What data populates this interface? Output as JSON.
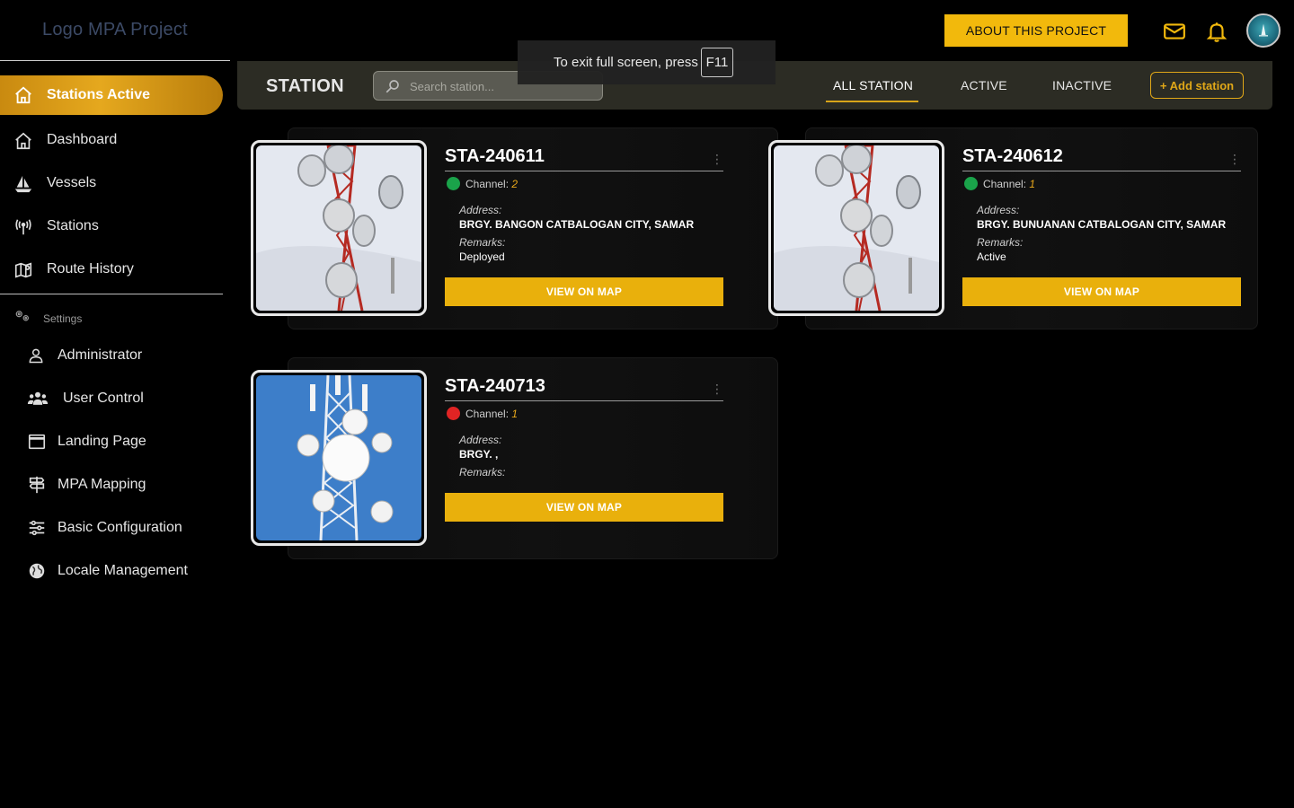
{
  "app": {
    "logo_text": "Logo MPA Project"
  },
  "sidebar": {
    "active_item": {
      "label": "Stations Active",
      "icon": "home-icon"
    },
    "items": [
      {
        "label": "Dashboard",
        "icon": "home-icon"
      },
      {
        "label": "Vessels",
        "icon": "sailboat-icon"
      },
      {
        "label": "Stations",
        "icon": "antenna-icon"
      },
      {
        "label": "Route History",
        "icon": "map-icon"
      }
    ],
    "settings_label": "Settings",
    "settings_items": [
      {
        "label": "Administrator",
        "icon": "user-icon"
      },
      {
        "label": "User Control",
        "icon": "users-icon"
      },
      {
        "label": "Landing Page",
        "icon": "window-icon"
      },
      {
        "label": "MPA Mapping",
        "icon": "signpost-icon"
      },
      {
        "label": "Basic Configuration",
        "icon": "sliders-icon"
      },
      {
        "label": "Locale Management",
        "icon": "globe-icon"
      }
    ]
  },
  "header": {
    "about_label": "ABOUT THIS PROJECT",
    "icons": [
      "mail-icon",
      "bell-icon",
      "avatar"
    ],
    "accent": "#f2b90c"
  },
  "fullscreen_toast": {
    "message": "To exit full screen, press",
    "key": "F11"
  },
  "toolbar": {
    "title": "STATION",
    "search_placeholder": "Search station...",
    "tabs": [
      {
        "label": "ALL STATION",
        "active": true
      },
      {
        "label": "ACTIVE",
        "active": false
      },
      {
        "label": "INACTIVE",
        "active": false
      }
    ],
    "add_label": "+ Add station"
  },
  "stations": [
    {
      "id": "STA-240611",
      "status_color": "#1aa34a",
      "channel_label": "Channel:",
      "channel": "2",
      "address_label": "Address:",
      "address": "BRGY. BANGON CATBALOGAN CITY, SAMAR",
      "remarks_label": "Remarks:",
      "remarks": "Deployed",
      "button": "VIEW ON MAP"
    },
    {
      "id": "STA-240612",
      "status_color": "#1aa34a",
      "channel_label": "Channel:",
      "channel": "1",
      "address_label": "Address:",
      "address": "BRGY. BUNUANAN CATBALOGAN CITY, SAMAR",
      "remarks_label": "Remarks:",
      "remarks": "Active",
      "button": "VIEW ON MAP"
    },
    {
      "id": "STA-240713",
      "status_color": "#e02424",
      "channel_label": "Channel:",
      "channel": "1",
      "address_label": "Address:",
      "address": "BRGY. ,",
      "remarks_label": "Remarks:",
      "remarks": "",
      "button": "VIEW ON MAP"
    }
  ]
}
